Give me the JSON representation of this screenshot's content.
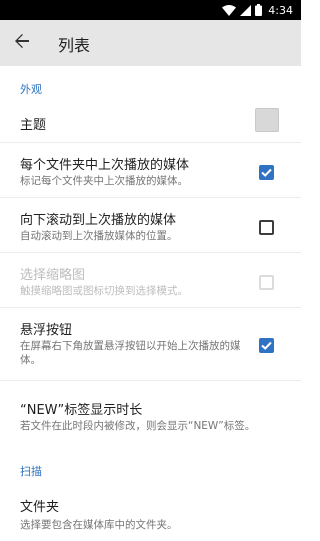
{
  "status_bar": {
    "time": "4:34",
    "icons": [
      "wifi-icon",
      "cell-signal-icon",
      "battery-icon"
    ]
  },
  "app_bar": {
    "back_icon": "arrow-back-icon",
    "title": "列表"
  },
  "sections": {
    "appearance": "外观",
    "scan": "扫描"
  },
  "prefs": {
    "theme": {
      "title": "主题",
      "swatch_color": "#d8d8d8"
    },
    "remember_last": {
      "title": "每个文件夹中上次播放的媒体",
      "summary": "标记每个文件夹中上次播放的媒体。",
      "checked": true
    },
    "scroll_down": {
      "title": "向下滚动到上次播放的媒体",
      "summary": "自动滚动到上次播放媒体的位置。",
      "checked": false
    },
    "select_thumbnail": {
      "title": "选择缩略图",
      "summary": "触摸缩略图或图标切换到选择模式。",
      "checked": false,
      "enabled": false
    },
    "floating_button": {
      "title": "悬浮按钮",
      "summary": "在屏幕右下角放置悬浮按钮以开始上次播放的媒体。",
      "checked": true
    },
    "new_label": {
      "title": "“NEW”标签显示时长",
      "summary": "若文件在此时段内被修改，则会显示“NEW”标签。"
    },
    "folders": {
      "title": "文件夹",
      "summary": "选择要包含在媒体库中的文件夹。"
    }
  },
  "colors": {
    "accent": "#2f73c2",
    "app_bar": "#e6e6e6",
    "status_bar": "#000000"
  }
}
